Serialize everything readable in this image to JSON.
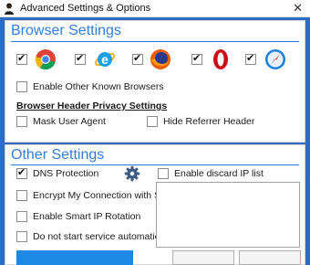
{
  "window": {
    "title": "Advanced Settings & Options",
    "close_glyph": "✕"
  },
  "browser_settings": {
    "title": "Browser Settings",
    "browsers": [
      {
        "name": "chrome-icon",
        "checked": true
      },
      {
        "name": "internet-explorer-icon",
        "checked": true
      },
      {
        "name": "firefox-icon",
        "checked": true
      },
      {
        "name": "opera-icon",
        "checked": true
      },
      {
        "name": "safari-icon",
        "checked": true
      }
    ],
    "enable_other_label": "Enable Other Known Browsers",
    "privacy_header": "Browser Header Privacy Settings",
    "mask_user_agent_label": "Mask User Agent",
    "hide_referrer_label": "Hide Referrer Header"
  },
  "other_settings": {
    "title": "Other Settings",
    "dns_protection_label": "DNS Protection",
    "encrypt_label": "Encrypt My Connection with SSL",
    "smart_ip_label": "Enable Smart IP Rotation",
    "no_autostart_label": "Do not start service automatically",
    "discard_ip_label": "Enable discard IP list",
    "ip_list_value": ""
  },
  "colors": {
    "accent": "#2f7ddc",
    "background": "#2b6cc4",
    "primary_button": "#1e88e5"
  }
}
